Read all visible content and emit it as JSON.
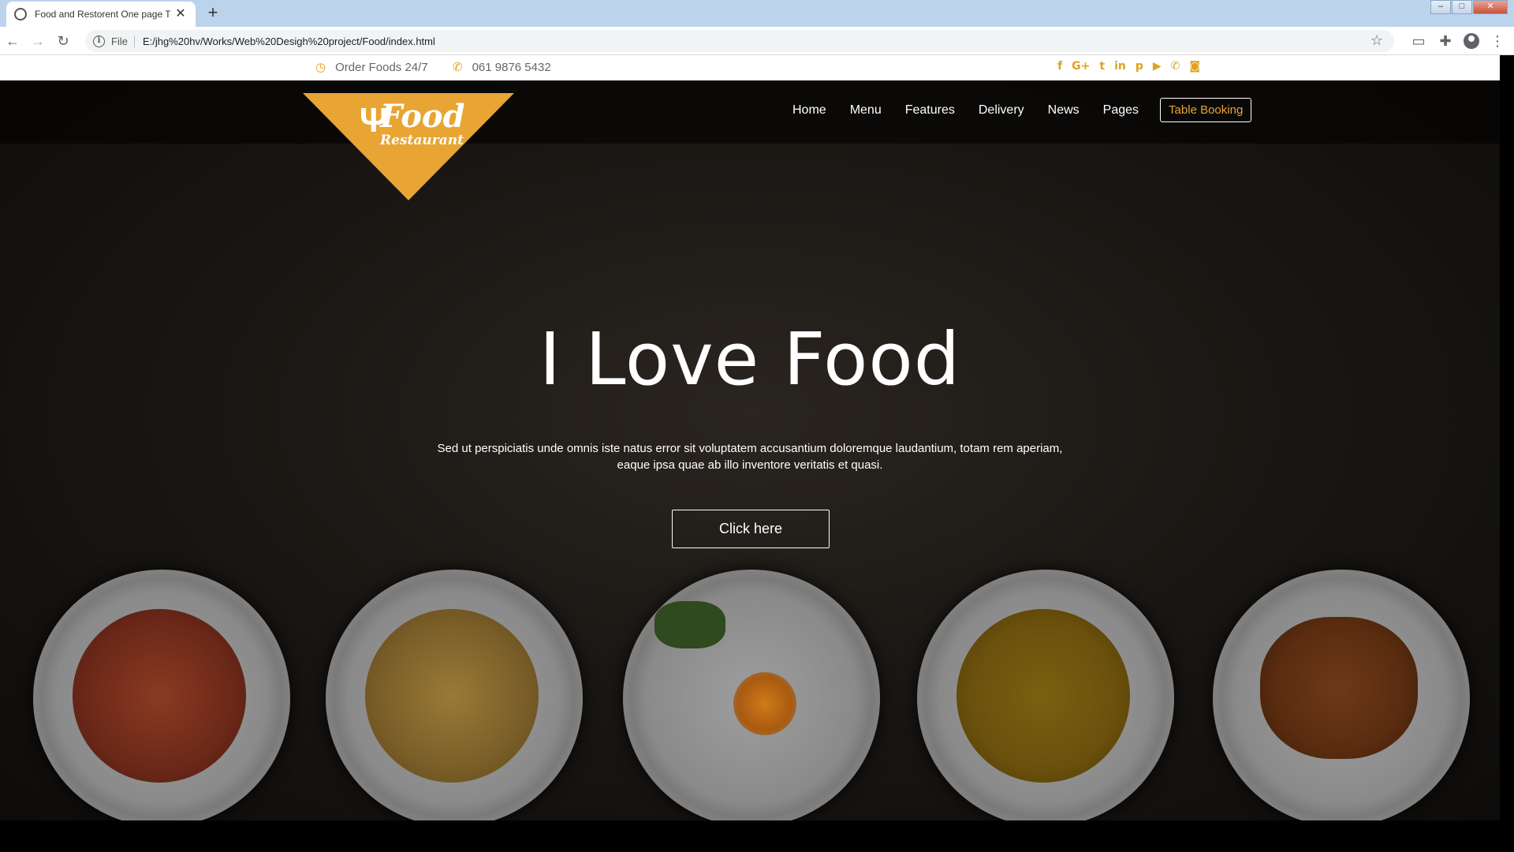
{
  "browser": {
    "tab_title": "Food and Restorent One page Te",
    "file_label": "File",
    "url": "E:/jhg%20hv/Works/Web%20Desigh%20project/Food/index.html"
  },
  "topbar": {
    "order_text": "Order Foods 24/7",
    "phone": "061 9876 5432",
    "social_icons": [
      "facebook-icon",
      "google-plus-icon",
      "twitter-icon",
      "linkedin-icon",
      "pinterest-icon",
      "youtube-icon",
      "phone-icon",
      "instagram-icon"
    ]
  },
  "logo": {
    "main": "Food",
    "sub": "Restaurant"
  },
  "nav": {
    "items": [
      "Home",
      "Menu",
      "Features",
      "Delivery",
      "News",
      "Pages"
    ],
    "booking": "Table Booking"
  },
  "hero": {
    "title": "I Love Food",
    "text": "Sed ut perspiciatis unde omnis iste natus error sit voluptatem accusantium doloremque laudantium, totam rem aperiam, eaque ipsa quae ab illo inventore veritatis et quasi.",
    "button": "Click here"
  },
  "colors": {
    "accent": "#e8a533",
    "hero_bg": "#181512"
  }
}
